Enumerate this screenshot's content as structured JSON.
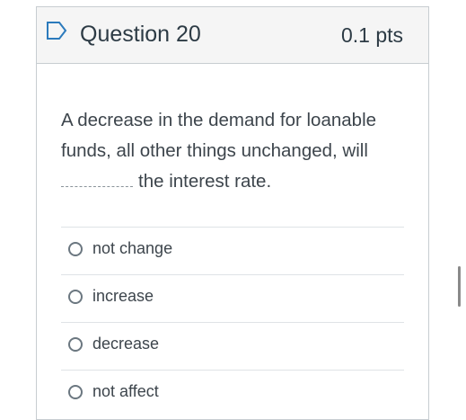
{
  "question": {
    "title": "Question 20",
    "points": "0.1 pts",
    "flag_icon": "flag-outline-icon",
    "accent_color": "#2b7abc",
    "text_before_blank": "A decrease in the demand for loanable funds, all other things unchanged, will ",
    "text_after_blank": "the interest rate."
  },
  "answers": [
    {
      "label": "not change",
      "selected": false
    },
    {
      "label": "increase",
      "selected": false
    },
    {
      "label": "decrease",
      "selected": false
    },
    {
      "label": "not affect",
      "selected": false
    }
  ]
}
